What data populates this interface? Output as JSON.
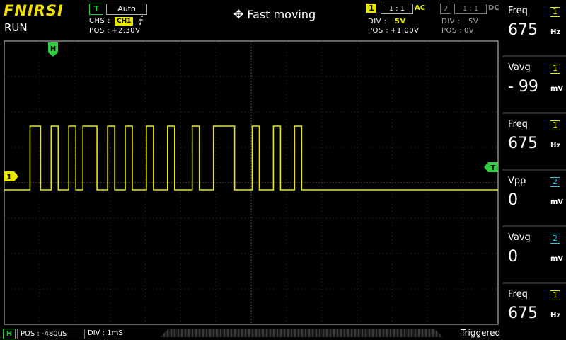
{
  "brand": "FNIRSI",
  "run_state": "RUN",
  "trigger": {
    "badge": "T",
    "mode": "Auto",
    "source_label": "CHS :",
    "source_value": "CH1",
    "edge_symbol": "⨍",
    "pos_label": "POS :",
    "pos_value": "+2.30V"
  },
  "move_mode": "Fast moving",
  "ch1": {
    "num": "1",
    "probe": "1 : 1",
    "coupling": "AC",
    "div_label": "DIV :",
    "div_value": "5V",
    "pos_label": "POS :",
    "pos_value": "+1.00V",
    "color": "#e8e800"
  },
  "ch2": {
    "num": "2",
    "probe": "1 : 1",
    "coupling": "DC",
    "div_label": "DIV :",
    "div_value": "5V",
    "pos_label": "POS :",
    "pos_value": "0V",
    "color": "#26c6da"
  },
  "markers": {
    "h": "H",
    "ch1": "1",
    "trig": "T"
  },
  "bottom": {
    "h_badge": "H",
    "pos": "POS : -480uS",
    "div": "DIV : 1mS",
    "status": "Triggered"
  },
  "measurements": [
    {
      "label": "Freq",
      "channel": "1",
      "value": "675",
      "unit": "Hz"
    },
    {
      "label": "Vavg",
      "channel": "1",
      "value": "- 99",
      "unit": "mV"
    },
    {
      "label": "Freq",
      "channel": "1",
      "value": "675",
      "unit": "Hz"
    },
    {
      "label": "Vpp",
      "channel": "2",
      "value": "0",
      "unit": "mV"
    },
    {
      "label": "Vavg",
      "channel": "2",
      "value": "0",
      "unit": "mV"
    },
    {
      "label": "Freq",
      "channel": "1",
      "value": "675",
      "unit": "Hz"
    }
  ],
  "waveform": {
    "pulses_ms": [
      [
        0.73,
        1.03
      ],
      [
        1.33,
        1.53
      ],
      [
        1.83,
        2.03
      ],
      [
        2.23,
        2.63
      ],
      [
        2.93,
        3.13
      ],
      [
        3.43,
        3.63
      ],
      [
        4.03,
        4.23
      ],
      [
        4.63,
        4.83
      ],
      [
        5.33,
        5.53
      ],
      [
        5.93,
        6.53
      ],
      [
        7.03,
        7.23
      ],
      [
        7.63,
        7.83
      ],
      [
        8.23,
        8.43
      ]
    ],
    "low_level_div": -0.2,
    "high_level_div": 1.6
  }
}
